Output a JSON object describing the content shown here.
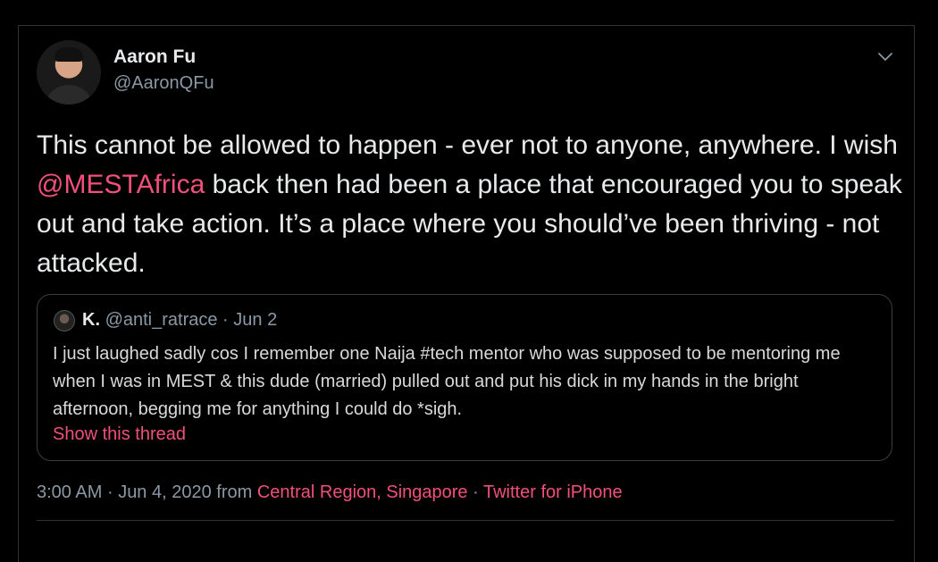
{
  "author": {
    "name": "Aaron Fu",
    "handle": "@AaronQFu"
  },
  "tweet": {
    "text_before": "This cannot be allowed to happen - ever not to anyone, anywhere. I wish ",
    "mention": "@MESTAfrica",
    "text_after": " back then had been a place that encouraged you to speak out and take action. It’s a place where you should’ve been thriving - not attacked."
  },
  "quote": {
    "name": "K.",
    "handle": "@anti_ratrace",
    "separator": "·",
    "date": "Jun 2",
    "text": "I just laughed sadly cos I remember one Naija #tech mentor who was supposed to be mentoring me when I was in MEST & this dude (married) pulled out and put his dick in my hands in the bright afternoon, begging me for anything I could do  *sigh.",
    "show_thread": "Show this thread"
  },
  "meta": {
    "time": "3:00 AM",
    "sep1": "·",
    "date": "Jun 4, 2020",
    "from": "from",
    "location": "Central Region, Singapore",
    "sep2": "·",
    "source": "Twitter for iPhone"
  },
  "colors": {
    "background": "#000000",
    "accent": "#f0507a",
    "secondary_text": "#8b98a5",
    "border": "#2f3336"
  },
  "icons": {
    "menu": "chevron-down-icon"
  }
}
